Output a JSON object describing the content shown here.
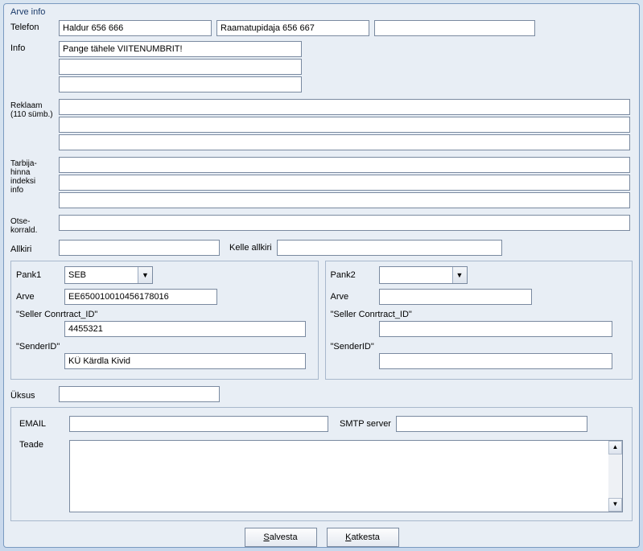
{
  "title": "Arve info",
  "labels": {
    "telefon": "Telefon",
    "info": "Info",
    "reklaam": "Reklaam",
    "reklaam_sub": "(110 sümb.)",
    "tarbija": "Tarbija-\nhinna\nindeksi\ninfo",
    "otsekorrald": "Otse-\nkorrald.",
    "allkiri": "Allkiri",
    "kelle_allkiri": "Kelle allkiri",
    "pank1": "Pank1",
    "pank2": "Pank2",
    "arve": "Arve",
    "seller": "\"Seller Conrtract_ID\"",
    "sender": "\"SenderID\"",
    "uksus": "Üksus",
    "email": "EMAIL",
    "smtp": "SMTP server",
    "teade": "Teade",
    "salvesta": "Salvesta",
    "katkesta": "Katkesta"
  },
  "telefon": {
    "v1": "Haldur 656 666",
    "v2": "Raamatupidaja 656 667",
    "v3": ""
  },
  "info": {
    "v1": "Pange tähele VIITENUMBRIT!",
    "v2": "",
    "v3": ""
  },
  "reklaam": {
    "v1": "",
    "v2": "",
    "v3": ""
  },
  "tarbija": {
    "v1": "",
    "v2": "",
    "v3": ""
  },
  "otsekorrald": "",
  "allkiri": "",
  "kelle_allkiri": "",
  "bank1": {
    "pank": "SEB",
    "arve": "EE650010010456178016",
    "seller": "4455321",
    "sender": "KÜ Kärdla Kivid"
  },
  "bank2": {
    "pank": "",
    "arve": "",
    "seller": "",
    "sender": ""
  },
  "uksus": "",
  "email": "",
  "smtp": "",
  "teade": ""
}
